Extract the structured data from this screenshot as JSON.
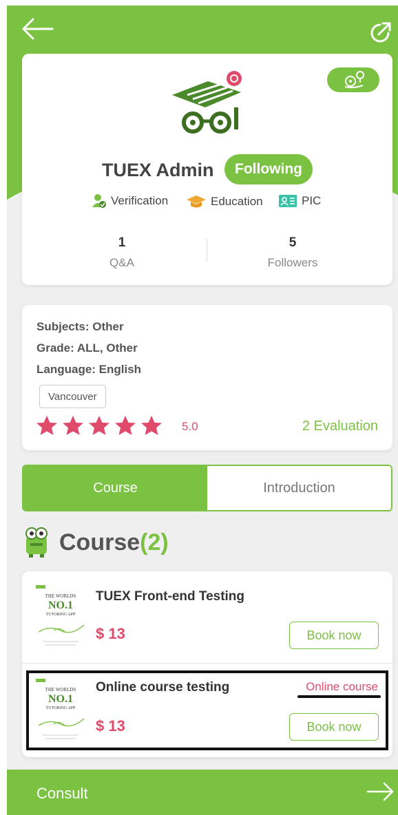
{
  "profile": {
    "name": "TUEX Admin",
    "follow_label": "Following",
    "badges": {
      "verification": "Verification",
      "education": "Education",
      "pic": "PIC"
    },
    "stats": {
      "qa_count": "1",
      "qa_label": "Q&A",
      "followers_count": "5",
      "followers_label": "Followers"
    }
  },
  "info": {
    "subjects": "Subjects: Other",
    "grade": "Grade: ALL, Other",
    "language": "Language: English",
    "city": "Vancouver",
    "rating_value": "5.0",
    "stars_filled": 5,
    "stars_total": 5,
    "evaluation": "2 Evaluation"
  },
  "tabs": {
    "course": "Course",
    "introduction": "Introduction",
    "active": "course"
  },
  "course_section": {
    "heading": "Course",
    "count": "(2)"
  },
  "courses": [
    {
      "title": "TUEX Front-end Testing",
      "price": "$ 13",
      "tag": "",
      "book_label": "Book now"
    },
    {
      "title": "Online course testing",
      "price": "$ 13",
      "tag": "Online course",
      "book_label": "Book now"
    }
  ],
  "thumbnail": {
    "line1": "THE WORLDS",
    "line2": "NO.1",
    "line3": "TUTORING APP"
  },
  "footer": {
    "consult_label": "Consult"
  },
  "colors": {
    "accent_green": "#7cc242",
    "price_pink": "#e04a6b",
    "background": "#efefef"
  },
  "icons": {
    "back": "arrow-left-icon",
    "share": "share-icon",
    "map": "map-pin-icon",
    "verification": "user-check-icon",
    "education": "graduation-cap-icon",
    "pic": "id-card-icon",
    "star": "star-icon",
    "course_mascot": "mascot-icon",
    "consult_arrow": "arrow-right-icon"
  }
}
